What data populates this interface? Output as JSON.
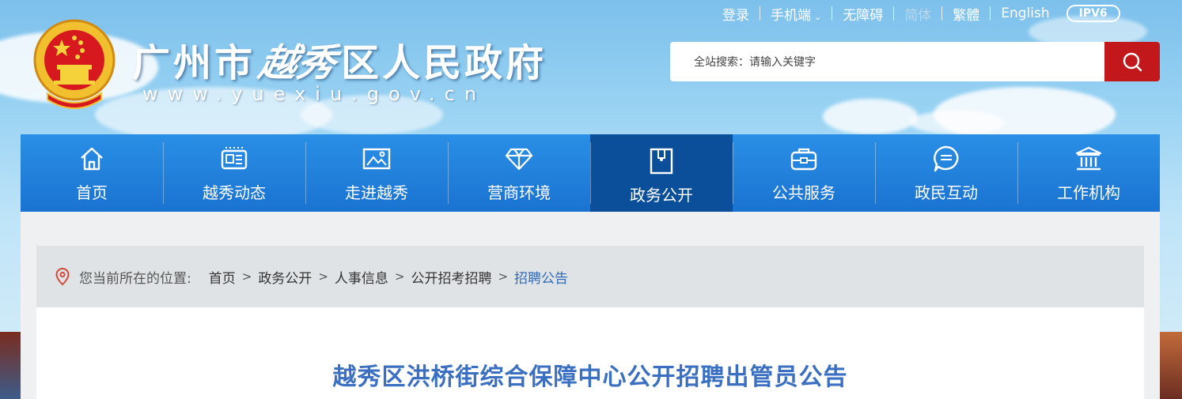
{
  "header": {
    "title_prefix": "广州市",
    "title_brush": "越秀",
    "title_suffix": "区人民政府",
    "url": "www.yuexiu.gov.cn"
  },
  "toplinks": {
    "login": "登录",
    "mobile": "手机端",
    "accessibility": "无障碍",
    "simplified": "简体",
    "traditional": "繁體",
    "english": "English",
    "ipv6": "IPV6"
  },
  "search": {
    "placeholder": "全站搜索：请输入关键字"
  },
  "nav": {
    "items": [
      {
        "label": "首页",
        "icon": "home-icon"
      },
      {
        "label": "越秀动态",
        "icon": "newspaper-icon"
      },
      {
        "label": "走进越秀",
        "icon": "image-icon"
      },
      {
        "label": "营商环境",
        "icon": "diamond-icon"
      },
      {
        "label": "政务公开",
        "icon": "folder-icon",
        "active": true
      },
      {
        "label": "公共服务",
        "icon": "briefcase-icon"
      },
      {
        "label": "政民互动",
        "icon": "chat-icon"
      },
      {
        "label": "工作机构",
        "icon": "institution-icon"
      }
    ]
  },
  "breadcrumb": {
    "prefix": "您当前所在的位置:",
    "items": [
      "首页",
      "政务公开",
      "人事信息",
      "公开招考招聘",
      "招聘公告"
    ],
    "separator": ">"
  },
  "article": {
    "title": "越秀区洪桥街综合保障中心公开招聘出管员公告"
  },
  "colors": {
    "nav_blue": "#1a73d1",
    "nav_active": "#0b4f9a",
    "search_red": "#c2181c",
    "title_blue": "#3a6fc2"
  }
}
